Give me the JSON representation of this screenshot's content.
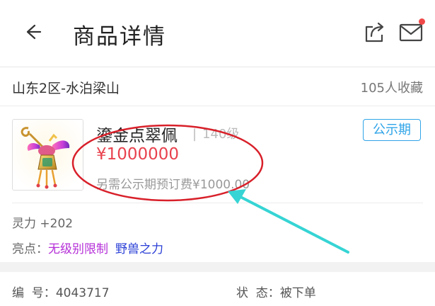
{
  "header": {
    "title": "商品详情",
    "back_icon": "back-arrow-icon",
    "share_icon": "share-icon",
    "mail_icon": "mail-icon",
    "notification_color": "#f04848"
  },
  "server": {
    "name": "山东2区-水泊梁山",
    "favorites": "105人收藏"
  },
  "item": {
    "name": "鎏金点翠佩",
    "separator": "|",
    "level": "140级",
    "price": "¥1000000",
    "reserve_fee": "另需公示期预订费¥1000.00",
    "status_badge": "公示期",
    "thumbnail_icon": "jade-pendant-icon"
  },
  "attributes": {
    "spirit": "灵力 +202",
    "highlights_label": "亮点：",
    "highlights": [
      {
        "text": "无级别限制",
        "color": "#b52fd8"
      },
      {
        "text": "野兽之力",
        "color": "#2a3fd6"
      }
    ]
  },
  "meta": {
    "serial_label": "编  号：",
    "serial_value": "4043717",
    "state_label": "状  态：",
    "state_value": "被下单"
  },
  "colors": {
    "price": "#e8424e",
    "badge": "#2fa4e8",
    "annotation_ellipse": "#d8202a",
    "annotation_arrow": "#36d4d4"
  }
}
